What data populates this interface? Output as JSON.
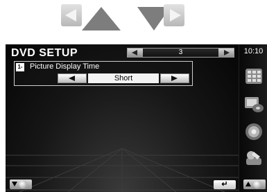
{
  "screen": {
    "title": "DVD SETUP",
    "page_number": "3",
    "clock": "10:10"
  },
  "setting": {
    "icon_text": "1-",
    "label": "Picture Display Time",
    "value": "Short"
  },
  "icons": {
    "nav_left": "left-arrow-icon",
    "nav_up": "up-triangle-icon",
    "nav_down": "down-triangle-icon",
    "nav_right": "right-arrow-icon",
    "return": "return-icon",
    "side": [
      "menu-grid-icon",
      "media-icon",
      "audio-speaker-icon",
      "setup-icon"
    ]
  },
  "colors": {
    "screen_background": "#000000",
    "text": "#ffffff",
    "nav_triangle": "#7d7d7d"
  }
}
